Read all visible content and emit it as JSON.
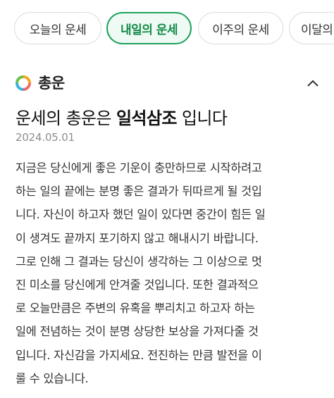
{
  "tabs": [
    {
      "label": "오늘의 운세",
      "active": false
    },
    {
      "label": "내일의 운세",
      "active": true
    },
    {
      "label": "이주의 운세",
      "active": false
    },
    {
      "label": "이달의 운세",
      "active": false
    }
  ],
  "section": {
    "title": "총운",
    "icon": "fortune-logo-icon",
    "collapse_icon": "chevron-up-icon"
  },
  "headline": {
    "prefix": "운세의 총운은 ",
    "keyword": "일석삼조",
    "suffix": " 입니다"
  },
  "date": "2024.05.01",
  "body_lines": [
    "지금은 당신에게 좋은 기운이 충만하므로 시작하려고",
    "하는 일의 끝에는 분명 좋은 결과가 뒤따르게 될 것입",
    "니다. 자신이 하고자 했던 일이 있다면 중간이 힘든 일",
    "이 생겨도 끝까지 포기하지 않고 해내시기 바랍니다.",
    "그로 인해 그 결과는 당신이 생각하는 그 이상으로 멋",
    "진 미소를 당신에게 안겨줄 것입니다. 또한 결과적으",
    "로 오늘만큼은 주변의 유혹을 뿌리치고 하고자 하는",
    "일에 전념하는 것이 분명 상당한 보상을 가져다줄 것",
    "입니다. 자신감을 가지세요. 전진하는 만큼 발전을 이",
    "룰 수 있습니다."
  ],
  "colors": {
    "accent": "#1fa35c",
    "accent_bg": "#eefaf3",
    "date": "#8e8e8e"
  }
}
